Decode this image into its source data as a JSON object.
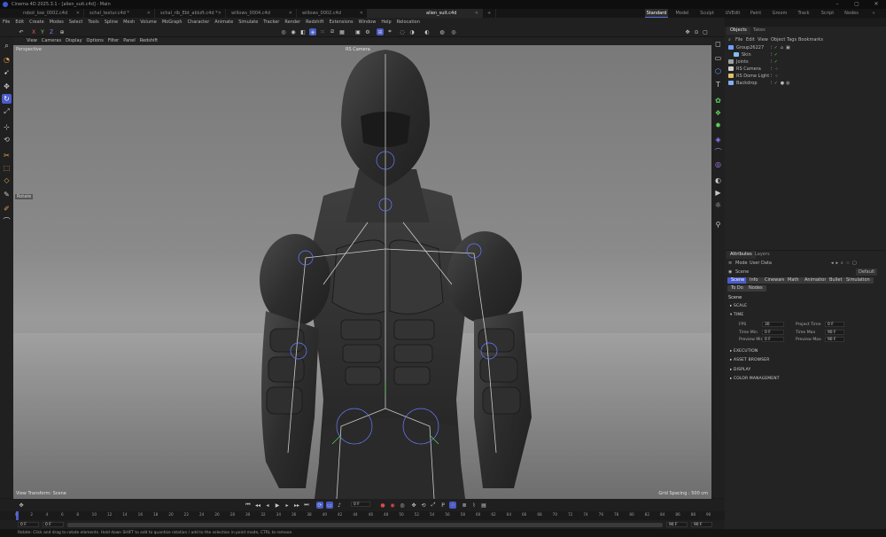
{
  "window": {
    "title": "Cinema 4D 2025.3.1 - [alien_suit.c4d] - Main",
    "controls": [
      "–",
      "▢",
      "✕"
    ]
  },
  "file_tabs": [
    {
      "label": "robot_low_0002.c4d",
      "active": false
    },
    {
      "label": "schal_textur.c4d *",
      "active": false
    },
    {
      "label": "schal_rib_Ebt_abluft.c4d *",
      "active": false
    },
    {
      "label": "willows_0004.c4d",
      "active": false
    },
    {
      "label": "willows_0002.c4d",
      "active": false
    },
    {
      "label": "alien_suit.c4d",
      "active": true
    }
  ],
  "layouts": [
    "Standard",
    "Model",
    "Sculpt",
    "UVEdit",
    "Paint",
    "Groom",
    "Track",
    "Script",
    "Nodes"
  ],
  "menu": [
    "File",
    "Edit",
    "Create",
    "Modes",
    "Select",
    "Tools",
    "Spline",
    "Mesh",
    "Volume",
    "MoGraph",
    "Character",
    "Animate",
    "Simulate",
    "Tracker",
    "Render",
    "Redshift",
    "Extensions",
    "Window",
    "Help",
    "Relocation"
  ],
  "viewport": {
    "menu": [
      "View",
      "Cameras",
      "Display",
      "Options",
      "Filter",
      "Panel",
      "Redshift"
    ],
    "label": "Perspective",
    "camera": "RS Camera",
    "side_label": "Rotate",
    "info_left": "View Transform: Scene",
    "info_right": "Grid Spacing : 500 cm"
  },
  "objects_panel": {
    "tabs": [
      "Objects",
      "Takes"
    ],
    "menu": [
      "File",
      "Edit",
      "View",
      "Object",
      "Tags",
      "Bookmarks"
    ],
    "items": [
      {
        "name": "Group26227",
        "indent": 0,
        "color": "#6fa0ff"
      },
      {
        "name": "Skin",
        "indent": 1,
        "color": "#7fc0ff"
      },
      {
        "name": "Joints",
        "indent": 0,
        "color": "#9fa0a0"
      },
      {
        "name": "RS Camera",
        "indent": 0,
        "color": "#d0d0d0"
      },
      {
        "name": "RS Dome Light",
        "indent": 0,
        "color": "#e0c060"
      },
      {
        "name": "Backdrop",
        "indent": 0,
        "color": "#80b0ff"
      }
    ]
  },
  "attributes_panel": {
    "tabs": [
      "Attributes",
      "Layers"
    ],
    "menu": [
      "Mode",
      "User Data"
    ],
    "mode_name": "Scene",
    "mode_value": "Default",
    "sub_tabs": [
      "Scene",
      "Info",
      "Cineware",
      "Math",
      "Animation",
      "Bullet",
      "Simulation",
      "To Do",
      "Nodes"
    ],
    "heading": "Scene",
    "sections": {
      "scale": "SCALE",
      "time": "TIME",
      "execution": "EXECUTION",
      "asset_browser": "ASSET BROWSER",
      "display": "DISPLAY",
      "color_management": "COLOR MANAGEMENT"
    },
    "time_fields": {
      "fps_label": "FPS",
      "fps": "30",
      "project_time_label": "Project Time",
      "project_time": "0 F",
      "time_min_label": "Time Min",
      "time_min": "0 F",
      "time_max_label": "Time Max",
      "time_max": "90 F",
      "preview_min_label": "Preview Min",
      "preview_min": "0 F",
      "preview_max_label": "Preview Max",
      "preview_max": "90 F"
    }
  },
  "timeline": {
    "current_frame": "0 F",
    "ticks": [
      "0",
      "2",
      "4",
      "6",
      "8",
      "10",
      "12",
      "14",
      "16",
      "18",
      "20",
      "22",
      "24",
      "26",
      "28",
      "30",
      "32",
      "34",
      "36",
      "38",
      "40",
      "42",
      "44",
      "46",
      "48",
      "50",
      "52",
      "54",
      "56",
      "58",
      "60",
      "62",
      "64",
      "66",
      "68",
      "70",
      "72",
      "74",
      "76",
      "78",
      "80",
      "82",
      "84",
      "86",
      "88",
      "90"
    ],
    "start": "0 F",
    "range_start": "0 F",
    "range_end": "90 F",
    "end": "90 F"
  },
  "status": "Rotate: Click and drag to rotate elements. Hold down SHIFT to add to quantize rotation / add to the selection in point mode, CTRL to remove.",
  "colors": {
    "accent": "#4a5cc8",
    "check": "#59c35a"
  }
}
